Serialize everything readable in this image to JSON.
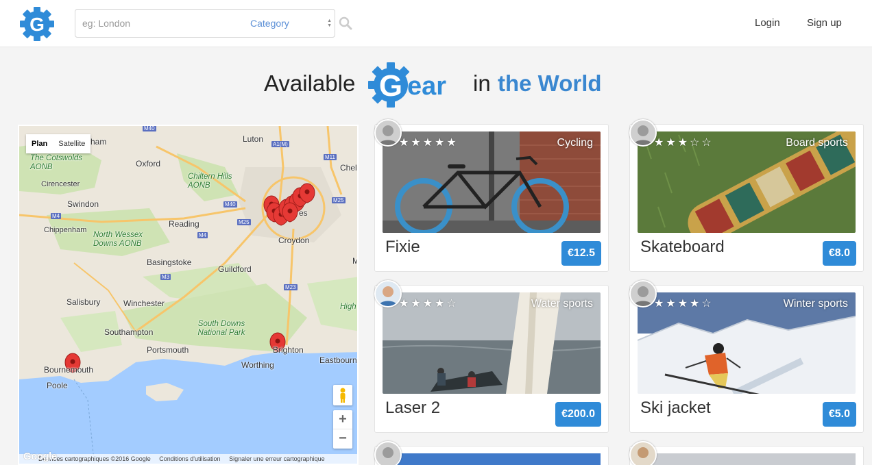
{
  "nav": {
    "search_placeholder": "eg: London",
    "category_label": "Category",
    "login": "Login",
    "signup": "Sign up"
  },
  "heading": {
    "available": "Available",
    "gear_logo_text": "Gear",
    "in": "in",
    "world": "the World"
  },
  "map": {
    "type_plan": "Plan",
    "type_satellite": "Satellite",
    "zoom_in": "+",
    "zoom_out": "−",
    "google": "Google",
    "footer": {
      "data": "Données cartographiques ©2016 Google",
      "terms": "Conditions d'utilisation",
      "report": "Signaler une erreur cartographique"
    },
    "labels": {
      "luton": "Luton",
      "oxford": "Oxford",
      "chilterns": "Chiltern Hills AONB",
      "cotswolds": "The Cotswolds AONB",
      "cirencester": "Cirencester",
      "swindon": "Swindon",
      "reading": "Reading",
      "chippenham": "Chippenham",
      "north_wessex": "North Wessex Downs AONB",
      "basingstoke": "Basingstoke",
      "croydon": "Croydon",
      "guildford": "Guildford",
      "salisbury": "Salisbury",
      "winchester": "Winchester",
      "south_downs": "South Downs National Park",
      "southampton": "Southampton",
      "portsmouth": "Portsmouth",
      "brighton": "Brighton",
      "worthing": "Worthing",
      "eastbourne": "Eastbourne",
      "bournemouth": "Bournemouth",
      "poole": "Poole",
      "high": "High",
      "chel": "Chel",
      "ham": "ham",
      "m": "M",
      "es": "es",
      "road_m40a": "M40",
      "road_a1m": "A1(M)",
      "road_m11": "M11",
      "road_m40b": "M40",
      "road_m25a": "M25",
      "road_m25b": "M25",
      "road_m4a": "M4",
      "road_m4b": "M4",
      "road_m3": "M3",
      "road_m23": "M23"
    }
  },
  "cards": [
    {
      "title": "Fixie",
      "price": "€12.5",
      "category": "Cycling",
      "rating": 5,
      "stars": "★★★★★"
    },
    {
      "title": "Skateboard",
      "price": "€8.0",
      "category": "Board sports",
      "rating": 3,
      "stars": "★★★☆☆"
    },
    {
      "title": "Laser 2",
      "price": "€200.0",
      "category": "Water sports",
      "rating": 4,
      "stars": "★★★★☆"
    },
    {
      "title": "Ski jacket",
      "price": "€5.0",
      "category": "Winter sports",
      "rating": 4,
      "stars": "★★★★☆"
    }
  ],
  "colors": {
    "brand_blue": "#2f8bd8",
    "marker_red": "#e53935"
  }
}
